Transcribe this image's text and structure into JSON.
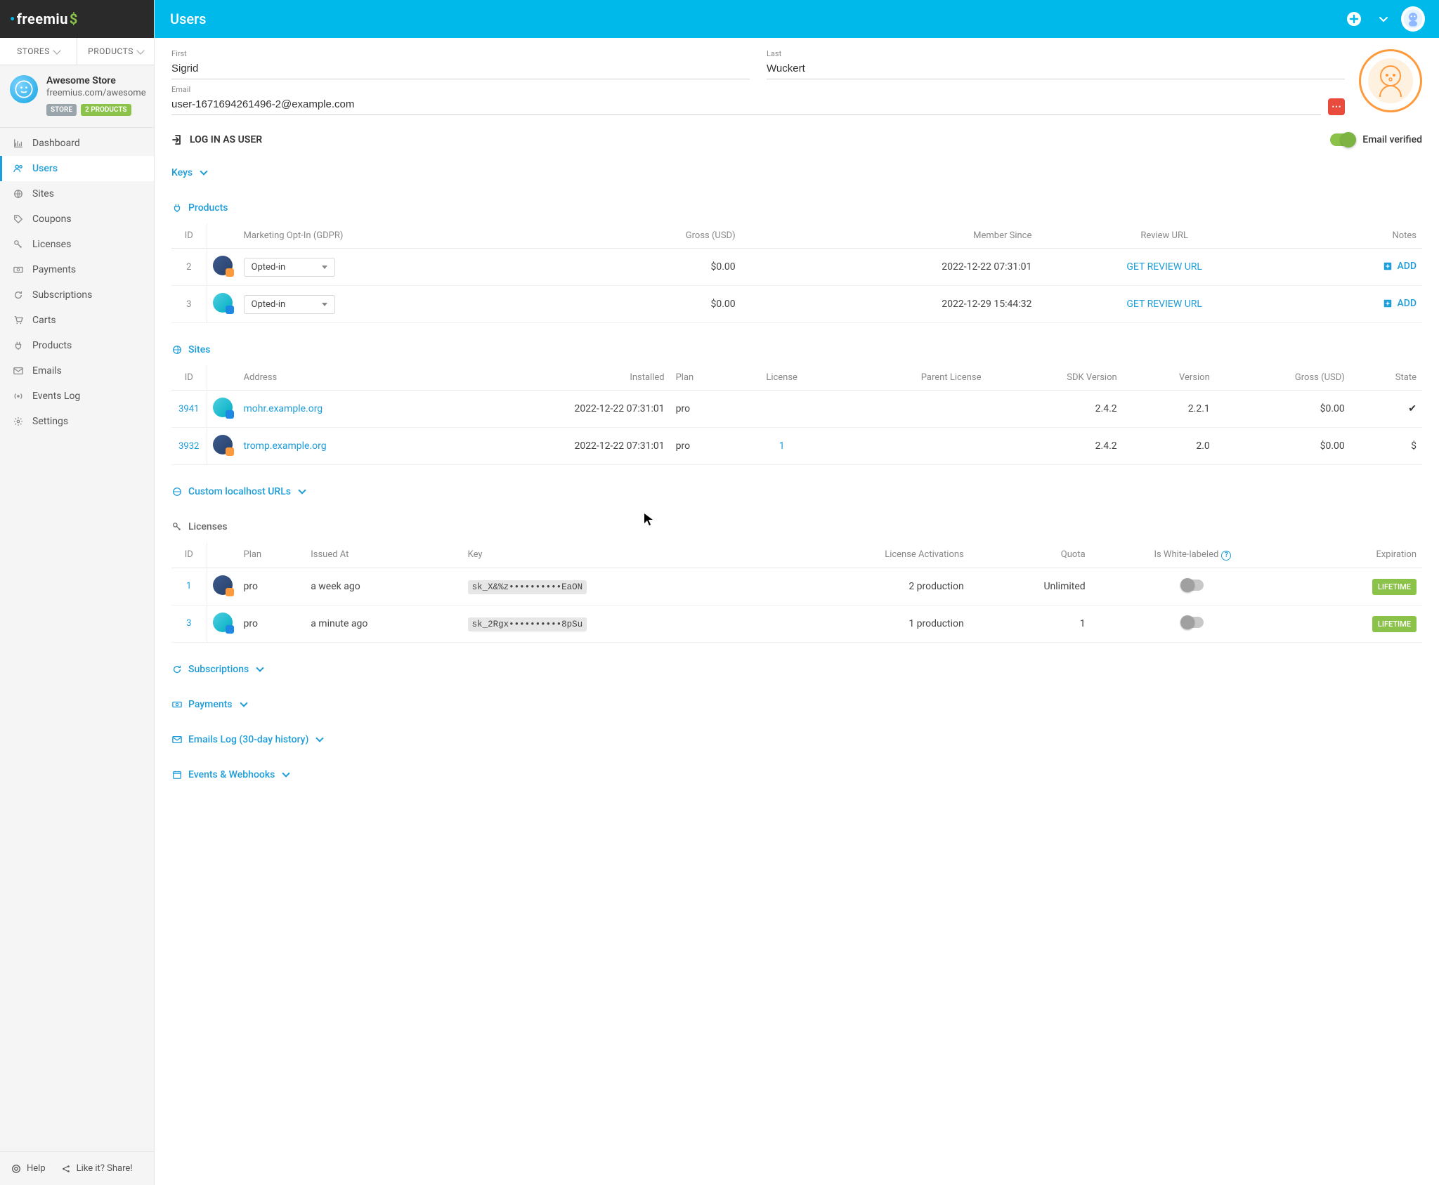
{
  "header": {
    "title": "Users"
  },
  "sidebar": {
    "logo": "freemius",
    "tabs": {
      "stores": "STORES",
      "products": "PRODUCTS"
    },
    "store": {
      "name": "Awesome Store",
      "url": "freemius.com/awesome",
      "badge_store": "STORE",
      "badge_products": "2 PRODUCTS"
    },
    "nav": {
      "dashboard": "Dashboard",
      "users": "Users",
      "sites": "Sites",
      "coupons": "Coupons",
      "licenses": "Licenses",
      "payments": "Payments",
      "subscriptions": "Subscriptions",
      "carts": "Carts",
      "products": "Products",
      "emails": "Emails",
      "events": "Events Log",
      "settings": "Settings"
    },
    "footer": {
      "help": "Help",
      "share": "Like it? Share!"
    }
  },
  "user": {
    "first_label": "First",
    "first_value": "Sigrid",
    "last_label": "Last",
    "last_value": "Wuckert",
    "email_label": "Email",
    "email_value": "user-1671694261496-2@example.com",
    "login_as_user": "LOG IN AS USER",
    "email_verified": "Email verified"
  },
  "sections": {
    "keys": "Keys",
    "products": "Products",
    "sites": "Sites",
    "custom_urls": "Custom localhost URLs",
    "licenses": "Licenses",
    "subscriptions": "Subscriptions",
    "payments": "Payments",
    "emails_log": "Emails Log (30-day history)",
    "events": "Events & Webhooks"
  },
  "products_table": {
    "headers": {
      "id": "ID",
      "marketing": "Marketing Opt-In (GDPR)",
      "gross": "Gross (USD)",
      "member_since": "Member Since",
      "review_url": "Review URL",
      "notes": "Notes"
    },
    "review_url_link": "GET REVIEW URL",
    "add_btn": "ADD",
    "rows": [
      {
        "id": "2",
        "optin": "Opted-in",
        "gross": "$0.00",
        "since": "2022-12-22 07:31:01"
      },
      {
        "id": "3",
        "optin": "Opted-in",
        "gross": "$0.00",
        "since": "2022-12-29 15:44:32"
      }
    ]
  },
  "sites_table": {
    "headers": {
      "id": "ID",
      "address": "Address",
      "installed": "Installed",
      "plan": "Plan",
      "license": "License",
      "parent_license": "Parent License",
      "sdk": "SDK Version",
      "version": "Version",
      "gross": "Gross (USD)",
      "state": "State"
    },
    "rows": [
      {
        "id": "3941",
        "address": "mohr.example.org",
        "installed": "2022-12-22 07:31:01",
        "plan": "pro",
        "license": "",
        "sdk": "2.4.2",
        "version": "2.2.1",
        "gross": "$0.00",
        "state": "check"
      },
      {
        "id": "3932",
        "address": "tromp.example.org",
        "installed": "2022-12-22 07:31:01",
        "plan": "pro",
        "license": "1",
        "sdk": "2.4.2",
        "version": "2.0",
        "gross": "$0.00",
        "state": "$"
      }
    ]
  },
  "licenses_table": {
    "headers": {
      "id": "ID",
      "plan": "Plan",
      "issued": "Issued At",
      "key": "Key",
      "activations": "License Activations",
      "quota": "Quota",
      "white": "Is White-labeled",
      "expiration": "Expiration"
    },
    "lifetime": "LIFETIME",
    "rows": [
      {
        "id": "1",
        "plan": "pro",
        "issued": "a week ago",
        "key": "sk_X&%z••••••••••EaON",
        "acts": "2 production",
        "quota": "Unlimited"
      },
      {
        "id": "3",
        "plan": "pro",
        "issued": "a minute ago",
        "key": "sk_2Rgx••••••••••8pSu",
        "acts": "1 production",
        "quota": "1"
      }
    ]
  }
}
